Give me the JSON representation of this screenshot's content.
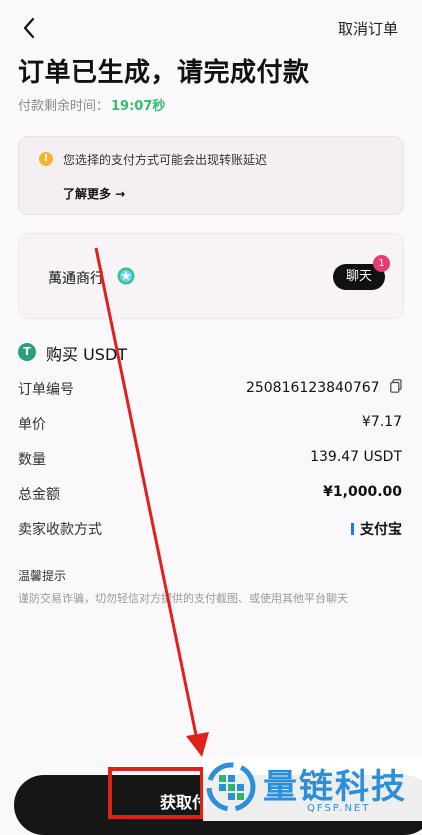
{
  "header": {
    "cancel_label": "取消订单"
  },
  "title": "订单已生成，请完成付款",
  "timer": {
    "label": "付款剩余时间：",
    "value": "19:07秒"
  },
  "notice": {
    "text": "您选择的支付方式可能会出现转账延迟",
    "learn_more": "了解更多 →",
    "icon_glyph": "!"
  },
  "merchant": {
    "name": "萬通商行",
    "chat_label": "聊天",
    "unread": "1"
  },
  "order": {
    "heading": "购买 USDT",
    "token_glyph": "T",
    "rows": [
      {
        "label": "订单编号",
        "value": "250816123840767"
      },
      {
        "label": "单价",
        "value": "¥7.17"
      },
      {
        "label": "数量",
        "value": "139.47 USDT"
      },
      {
        "label": "总金额",
        "value": "¥1,000.00"
      },
      {
        "label": "卖家收款方式",
        "value": "支付宝"
      }
    ]
  },
  "tips": {
    "title": "温馨提示",
    "body": "谨防交易诈骗，切勿轻信对方提供的支付截图、或使用其他平台聊天"
  },
  "bottom": {
    "primary_label": "获取付"
  },
  "watermark": {
    "brand": "量链科技",
    "domain": "QFSP.NET"
  },
  "colors": {
    "accent_green": "#2ebf6f",
    "badge_pink": "#e53b6e",
    "annotation_red": "#e0211a",
    "watermark_blue": "#2b8fd9"
  }
}
